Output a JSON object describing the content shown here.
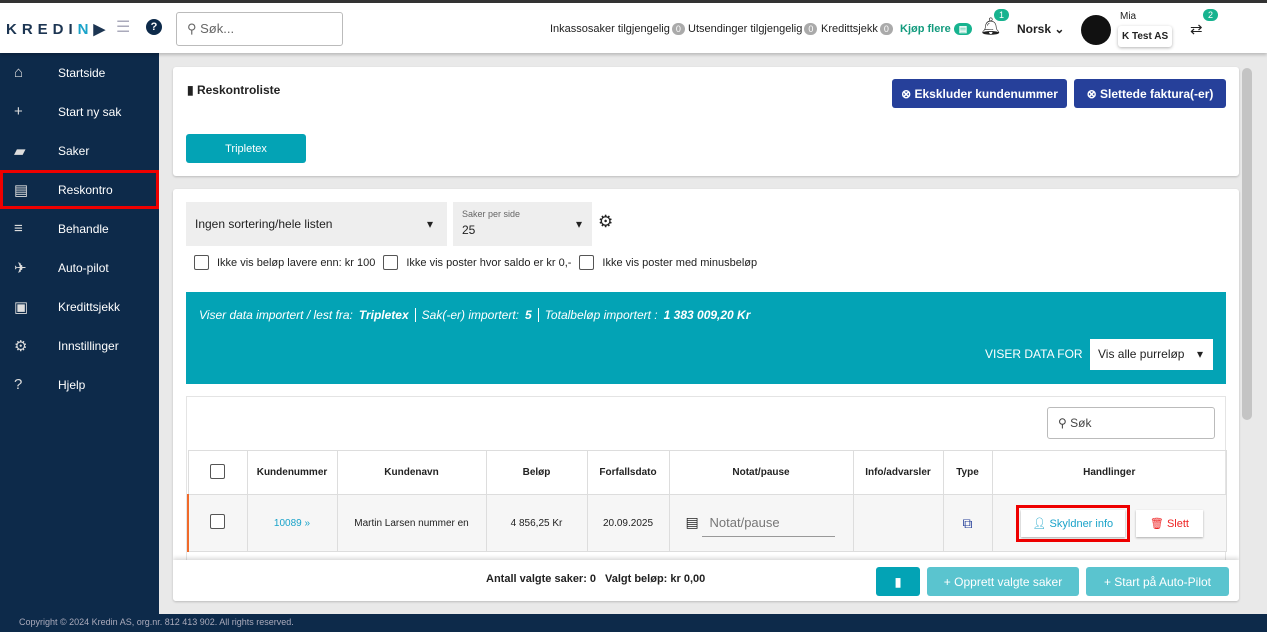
{
  "header": {
    "logo": "KREDIN",
    "search_placeholder": "Søk...",
    "stats": [
      {
        "label": "Inkassosaker tilgjengelig",
        "count": "0"
      },
      {
        "label": "Utsendinger tilgjengelig",
        "count": "0"
      },
      {
        "label": "Kredittsjekk",
        "count": "0"
      }
    ],
    "buy_more": "Kjøp flere",
    "notif_count": "1",
    "language": "Norsk",
    "user_name": "Mia",
    "company": "K Test AS",
    "switch_count": "2"
  },
  "sidebar": {
    "items": [
      {
        "label": "Startside",
        "icon": "⌂"
      },
      {
        "label": "Start ny sak",
        "icon": "+"
      },
      {
        "label": "Saker",
        "icon": "▰"
      },
      {
        "label": "Reskontro",
        "icon": "▤"
      },
      {
        "label": "Behandle",
        "icon": "≡"
      },
      {
        "label": "Auto-pilot",
        "icon": "✈"
      },
      {
        "label": "Kredittsjekk",
        "icon": "▣"
      },
      {
        "label": "Innstillinger",
        "icon": "⚙"
      },
      {
        "label": "Hjelp",
        "icon": "?"
      }
    ]
  },
  "main": {
    "title": "Reskontroliste",
    "exclude_btn": "Ekskluder kundenummer",
    "deleted_btn": "Slettede faktura(-er)",
    "source_tab": "Tripletex",
    "sort_select": "Ingen sortering/hele listen",
    "per_page_label": "Saker per side",
    "per_page": "25",
    "checks": [
      "Ikke vis beløp lavere enn: kr 100",
      "Ikke vis poster hvor saldo er kr 0,-",
      "Ikke vis poster med minusbeløp"
    ],
    "banner": {
      "source_label": "Viser data importert / lest fra:",
      "source": "Tripletex",
      "imported_label": "Sak(-er) importert:",
      "imported": "5",
      "total_label": "Totalbeløp importert :",
      "total": "1 383 009,20 Kr",
      "filter_label": "VISER DATA FOR",
      "filter_value": "Vis alle purreløp"
    },
    "table_search": "Søk",
    "columns": [
      "Kundenummer",
      "Kundenavn",
      "Beløp",
      "Forfallsdato",
      "Notat/pause",
      "Info/advarsler",
      "Type",
      "Handlinger"
    ],
    "row": {
      "kundenummer": "10089",
      "kundenavn": "Martin Larsen nummer en",
      "belop": "4 856,25 Kr",
      "forfall": "20.09.2025",
      "notat_placeholder": "Notat/pause",
      "debtor_btn": "Skyldner info",
      "delete_btn": "Slett"
    },
    "bottom": {
      "selected_count": "Antall valgte saker: 0",
      "selected_amount": "Valgt beløp: kr 0,00",
      "create_btn": "Opprett valgte saker",
      "autopilot_btn": "Start på Auto-Pilot"
    }
  },
  "footer": "Copyright © 2024 Kredin AS, org.nr. 812 413 902. All rights reserved."
}
